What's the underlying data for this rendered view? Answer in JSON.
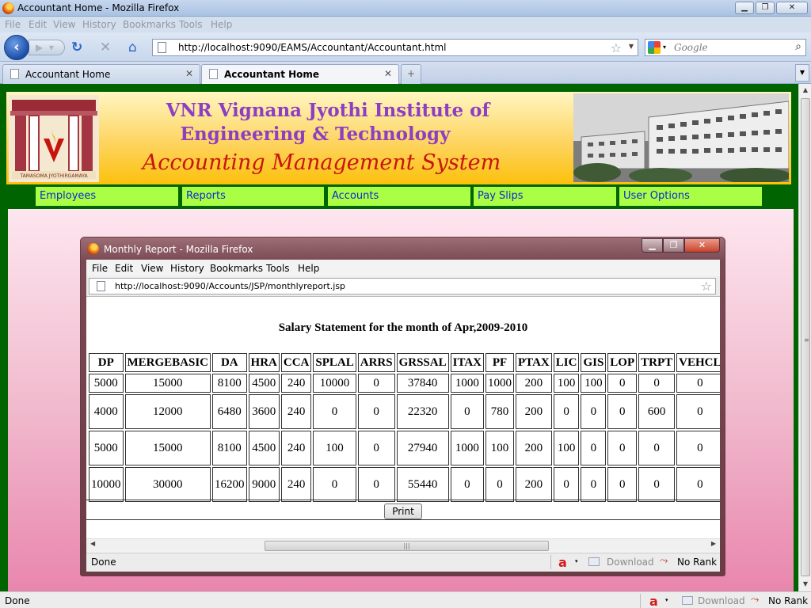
{
  "browser": {
    "window_title": "Accountant Home - Mozilla Firefox",
    "menu": [
      "File",
      "Edit",
      "View",
      "History",
      "Bookmarks",
      "Tools",
      "Help"
    ],
    "url": "http://localhost:9090/EAMS/Accountant/Accountant.html",
    "search_placeholder": "Google",
    "tabs": [
      {
        "label": "Accountant Home",
        "active": false
      },
      {
        "label": "Accountant Home",
        "active": true
      }
    ],
    "new_tab_glyph": "+",
    "status": "Done",
    "status_download": "Download",
    "status_rank": "No Rank"
  },
  "site": {
    "title_line1": "VNR Vignana Jyothi Institute of",
    "title_line2": "Engineering & Technology",
    "title_line3": "Accounting Management System",
    "logo_caption": "TAMASOMA JYOTHIRGAMAYA",
    "menu": [
      "Employees",
      "Reports",
      "Accounts",
      "Pay Slips",
      "User Options"
    ]
  },
  "popup": {
    "window_title": "Monthly Report - Mozilla Firefox",
    "menu": [
      "File",
      "Edit",
      "View",
      "History",
      "Bookmarks",
      "Tools",
      "Help"
    ],
    "url": "http://localhost:9090/Accounts/JSP/monthlyreport.jsp",
    "status": "Done",
    "status_download": "Download",
    "status_rank": "No Rank"
  },
  "report": {
    "title": "Salary Statement for the month of Apr,2009-2010",
    "columns": [
      "DP",
      "MERGEBASIC",
      "DA",
      "HRA",
      "CCA",
      "SPLAL",
      "ARRS",
      "GRSSAL",
      "ITAX",
      "PF",
      "PTAX",
      "LIC",
      "GIS",
      "LOP",
      "TRPT",
      "VEHCL"
    ],
    "rows": [
      [
        "5000",
        "15000",
        "8100",
        "4500",
        "240",
        "10000",
        "0",
        "37840",
        "1000",
        "1000",
        "200",
        "100",
        "100",
        "0",
        "0",
        "0"
      ],
      [
        "4000",
        "12000",
        "6480",
        "3600",
        "240",
        "0",
        "0",
        "22320",
        "0",
        "780",
        "200",
        "0",
        "0",
        "0",
        "600",
        "0"
      ],
      [
        "5000",
        "15000",
        "8100",
        "4500",
        "240",
        "100",
        "0",
        "27940",
        "1000",
        "100",
        "200",
        "100",
        "0",
        "0",
        "0",
        "0"
      ],
      [
        "10000",
        "30000",
        "16200",
        "9000",
        "240",
        "0",
        "0",
        "55440",
        "0",
        "0",
        "200",
        "0",
        "0",
        "0",
        "0",
        "0"
      ]
    ],
    "print_label": "Print"
  },
  "colors": {
    "page_bg": "#006400",
    "menu_bg": "#aaff44",
    "menu_text": "#0a2ad8",
    "title_purple": "#8d3ec3",
    "subtitle_red": "#c8140f"
  }
}
